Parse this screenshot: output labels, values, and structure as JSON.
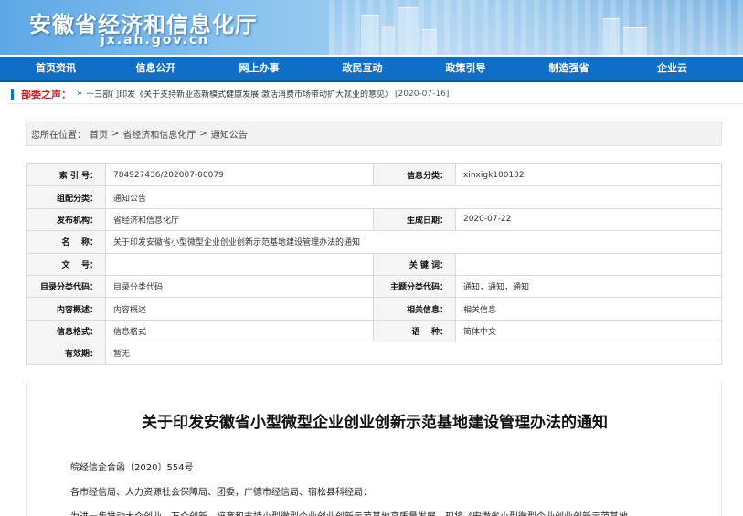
{
  "header": {
    "site_title": "安徽省经济和信息化厅",
    "site_domain": "jx.ah.gov.cn"
  },
  "nav": {
    "items": [
      "首页资讯",
      "信息公开",
      "网上办事",
      "政民互动",
      "政策引导",
      "制造强省",
      "企业云"
    ]
  },
  "notice": {
    "label": "部委之声：",
    "text": "十三部门印发《关于支持新业态新模式健康发展 激活消费市场带动扩大就业的意见》",
    "date": "[2020-07-16]"
  },
  "breadcrumb": {
    "prefix": "您所在位置：",
    "items": [
      "首页",
      "省经济和信息化厅",
      "通知公告"
    ],
    "separator": ">"
  },
  "meta": {
    "index_label": "索 引 号：",
    "index_value": "784927436/202007-00079",
    "category_label": "信息分类：",
    "category_value": "xinxigk100102",
    "group_label": "组配分类：",
    "group_value": "通知公告",
    "publisher_label": "发布机构：",
    "publisher_value": "省经济和信息化厅",
    "date_label": "生成日期：",
    "date_value": "2020-07-22",
    "name_label": "名    称：",
    "name_value": "关于印发安徽省小型微型企业创业创新示范基地建设管理办法的通知",
    "docno_label": "文    号：",
    "docno_value": "",
    "keywords_label": "关 键 词：",
    "keywords_value": "",
    "catalog_label": "目录分类代码：",
    "catalog_value": "目录分类代码",
    "topic_label": "主题分类代码：",
    "topic_value": "通知，通知，通知",
    "summary_label": "内容概述：",
    "summary_value": "内容概述",
    "related_label": "相关信息：",
    "related_value": "相关信息",
    "format_label": "信息格式：",
    "format_value": "信息格式",
    "lang_label": "语    种：",
    "lang_value": "简体中文",
    "validity_label": "有效期：",
    "validity_value": "暂无"
  },
  "article": {
    "title": "关于印发安徽省小型微型企业创业创新示范基地建设管理办法的通知",
    "docnum": "皖经信企合函〔2020〕554号",
    "recipients": "各市经信局、人力资源社会保障局、团委，广德市经信局、宿松县科经局：",
    "body_start": "为进一步推动大众创业、万众创新，培育和支持小型微型企业创业创新示范基地高质量发展，现将《安徽省小型微型企业创业创新示范基地"
  },
  "colors": {
    "nav_bg": "#0f6fc6",
    "accent_red": "#c0282d",
    "accent_blue": "#1a6fc2"
  }
}
